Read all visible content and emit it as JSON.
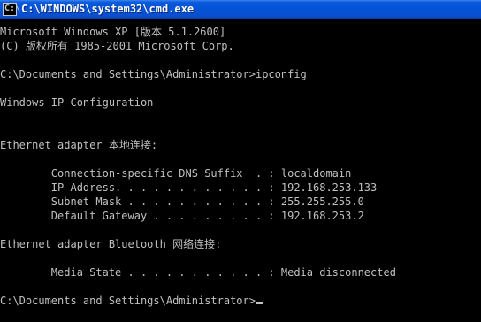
{
  "window": {
    "title": "C:\\WINDOWS\\system32\\cmd.exe",
    "icon": "cmd-icon"
  },
  "console": {
    "lines": [
      "Microsoft Windows XP [版本 5.1.2600]",
      "(C) 版权所有 1985-2001 Microsoft Corp.",
      "",
      "C:\\Documents and Settings\\Administrator>ipconfig",
      "",
      "Windows IP Configuration",
      "",
      "",
      "Ethernet adapter 本地连接:",
      "",
      "        Connection-specific DNS Suffix  . : localdomain",
      "        IP Address. . . . . . . . . . . . : 192.168.253.133",
      "        Subnet Mask . . . . . . . . . . . : 255.255.255.0",
      "        Default Gateway . . . . . . . . . : 192.168.253.2",
      "",
      "Ethernet adapter Bluetooth 网络连接:",
      "",
      "        Media State . . . . . . . . . . . : Media disconnected",
      "",
      "C:\\Documents and Settings\\Administrator>"
    ]
  },
  "colors": {
    "background": "#000000",
    "text": "#c0c0c0",
    "titlebar": "#0553d6"
  }
}
